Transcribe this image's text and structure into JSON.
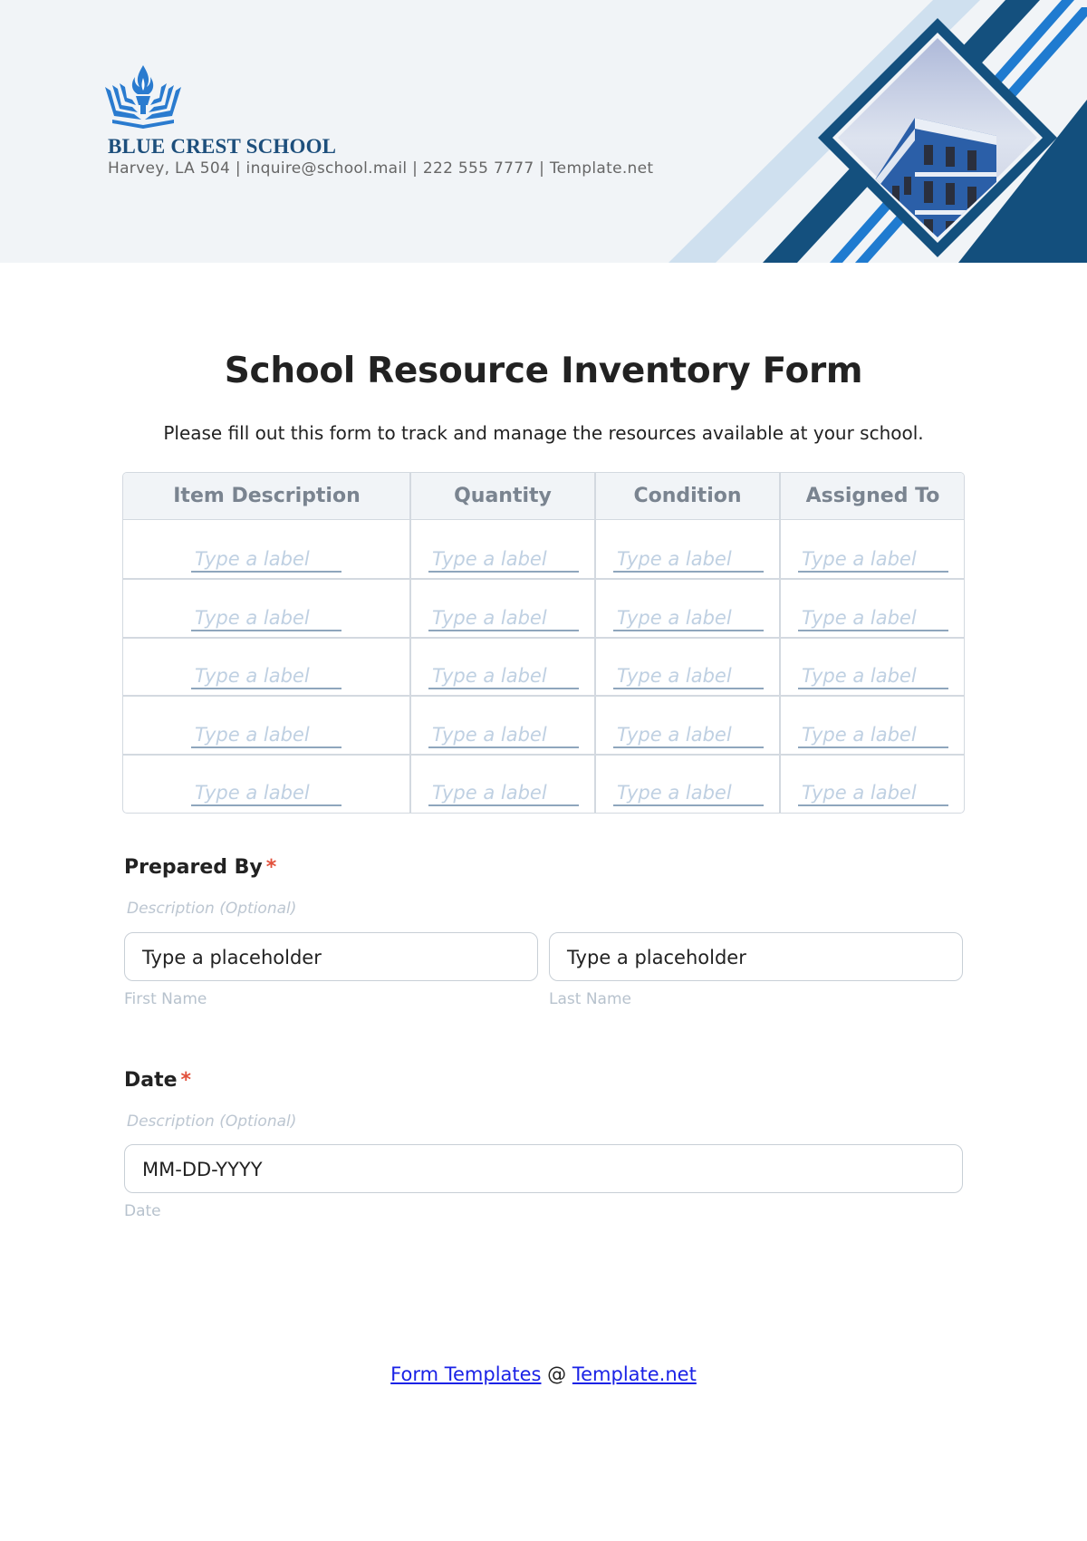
{
  "header": {
    "school_name": "BLUE CREST SCHOOL",
    "contact": "Harvey, LA 504 | inquire@school.mail | 222 555 7777 | Template.net",
    "colors": {
      "brand_dark": "#1d4f7c",
      "brand_blue": "#1f7bd0",
      "light_blue": "#cfe0ef",
      "header_bg": "#f1f4f7"
    }
  },
  "form": {
    "title": "School Resource Inventory Form",
    "subtitle": "Please fill out this form to track and manage the resources available at your school."
  },
  "table": {
    "headers": [
      "Item Description",
      "Quantity",
      "Condition",
      "Assigned To"
    ],
    "rows": [
      [
        "Type a label",
        "Type a label",
        "Type a label",
        "Type a label"
      ],
      [
        "Type a label",
        "Type a label",
        "Type a label",
        "Type a label"
      ],
      [
        "Type a label",
        "Type a label",
        "Type a label",
        "Type a label"
      ],
      [
        "Type a label",
        "Type a label",
        "Type a label",
        "Type a label"
      ],
      [
        "Type a label",
        "Type a label",
        "Type a label",
        "Type a label"
      ]
    ]
  },
  "prepared_by": {
    "label": "Prepared By",
    "required_mark": "*",
    "description": "Description (Optional)",
    "first_name_placeholder": "Type a placeholder",
    "first_name_label": "First Name",
    "last_name_placeholder": "Type a placeholder",
    "last_name_label": "Last Name"
  },
  "date": {
    "label": "Date",
    "required_mark": "*",
    "description": "Description (Optional)",
    "placeholder": "MM-DD-YYYY",
    "sublabel": "Date"
  },
  "footer": {
    "link1": "Form Templates",
    "separator": " @ ",
    "link2": "Template.net"
  }
}
